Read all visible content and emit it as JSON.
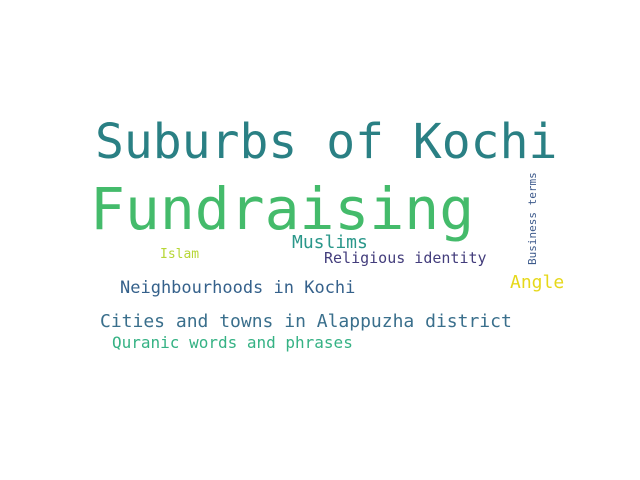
{
  "words": [
    {
      "text": "Suburbs of Kochi",
      "color": "#2a8084"
    },
    {
      "text": "Fundraising",
      "color": "#44bb6b"
    },
    {
      "text": "Muslims",
      "color": "#2a978a"
    },
    {
      "text": "Islam",
      "color": "#b7d636"
    },
    {
      "text": "Religious identity",
      "color": "#433d7c"
    },
    {
      "text": "Angle",
      "color": "#e6d81a"
    },
    {
      "text": "Neighbourhoods in Kochi",
      "color": "#35618b"
    },
    {
      "text": "Cities and towns in Alappuzha district",
      "color": "#3a6f8c"
    },
    {
      "text": "Quranic words and phrases",
      "color": "#35b284"
    },
    {
      "text": "Business terms",
      "color": "#3e5b8c"
    }
  ]
}
